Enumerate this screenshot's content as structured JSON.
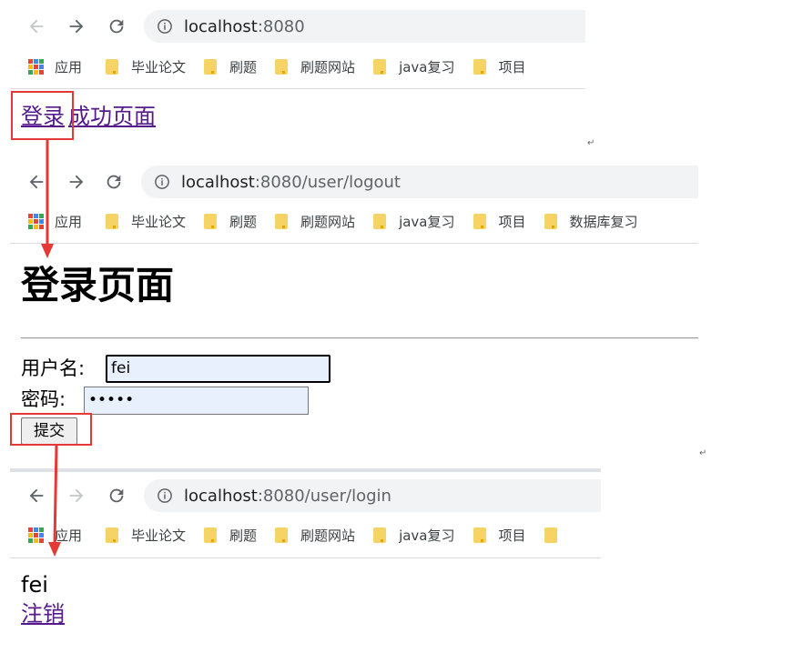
{
  "browser1": {
    "url_host": "localhost",
    "url_path": ":8080",
    "bookmarks": [
      "应用",
      "毕业论文",
      "刷题",
      "刷题网站",
      "java复习",
      "项目"
    ]
  },
  "page1": {
    "links": [
      "登录",
      "成功页面"
    ]
  },
  "browser2": {
    "url_host": "localhost",
    "url_path": ":8080/user/logout",
    "bookmarks": [
      "应用",
      "毕业论文",
      "刷题",
      "刷题网站",
      "java复习",
      "项目",
      "数据库复习"
    ]
  },
  "page2": {
    "heading": "登录页面",
    "username_label": "用户名:",
    "username_value": "fei",
    "password_label": "密码:",
    "password_value": "•••••",
    "submit_label": "提交"
  },
  "browser3": {
    "url_host": "localhost",
    "url_path": ":8080/user/login",
    "bookmarks": [
      "应用",
      "毕业论文",
      "刷题",
      "刷题网站",
      "java复习",
      "项目"
    ]
  },
  "page3": {
    "username": "fei",
    "logout_link": "注销"
  },
  "return_mark": "↵",
  "colors": {
    "annotation": "#e53935",
    "link": "#551a8b",
    "autofill_bg": "#e8f0fe",
    "folder": "#f6d365"
  }
}
